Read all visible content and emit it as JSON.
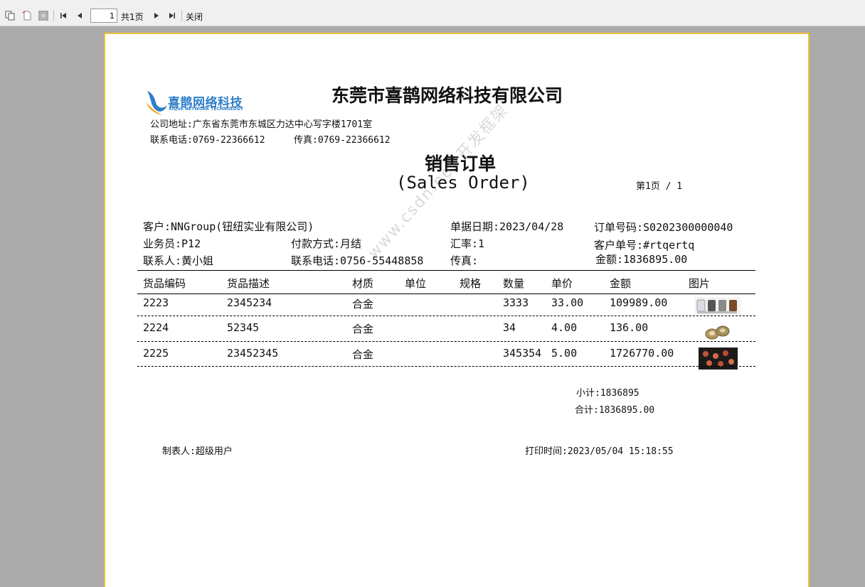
{
  "toolbar": {
    "page_value": "1",
    "total_pages": "共1页",
    "close_label": "关闭",
    "buttons": [
      "copy-icon",
      "export-icon",
      "print-icon",
      "first-page-icon",
      "prev-page-icon",
      "next-page-icon",
      "last-page-icon"
    ]
  },
  "header": {
    "logo_text": "喜鹊网络科技",
    "logo_sub": "XIQUE NETWORK TECHNOLOGY",
    "company_name": "东莞市喜鹊网络科技有限公司",
    "address": "公司地址:广东省东莞市东城区力达中心写字楼1701室",
    "phone": "联系电话:0769-22366612",
    "fax": "传真:0769-22366612"
  },
  "title": {
    "cn": "销售订单",
    "en": "(Sales Order)",
    "page_info": "第1页 / 1"
  },
  "info": {
    "customer": "客户:NNGroup(钮纽实业有限公司)",
    "doc_date": "单据日期:2023/04/28",
    "order_no": "订单号码:S0202300000040",
    "salesman": "业务员:P12",
    "payment": "付款方式:月结",
    "rate": "汇率:1",
    "customer_no": "客户单号:#rtqertq",
    "contact": "联系人:黄小姐",
    "contact_phone": "联系电话:0756-55448858",
    "fax": "传真:",
    "amount": "金额:1836895.00"
  },
  "table": {
    "headers": [
      "货品编码",
      "货品描述",
      "材质",
      "单位",
      "规格",
      "数量",
      "单价",
      "金额",
      "图片"
    ],
    "rows": [
      {
        "code": "2223",
        "desc": "2345234",
        "material": "合金",
        "unit": "",
        "spec": "",
        "qty": "3333",
        "price": "33.00",
        "amount": "109989.00",
        "image": "product-image-bottles"
      },
      {
        "code": "2224",
        "desc": "52345",
        "material": "合金",
        "unit": "",
        "spec": "",
        "qty": "34",
        "price": "4.00",
        "amount": "136.00",
        "image": "product-image-buttons"
      },
      {
        "code": "2225",
        "desc": "23452345",
        "material": "合金",
        "unit": "",
        "spec": "",
        "qty": "345354",
        "price": "5.00",
        "amount": "1726770.00",
        "image": "product-image-parts"
      }
    ]
  },
  "totals": {
    "subtotal": "小计:1836895",
    "total": "合计:1836895.00"
  },
  "footer": {
    "maker": "制表人:超级用户",
    "print_time": "打印时间:2023/05/04 15:18:55"
  },
  "watermark": "www.csdn.net 开发框架"
}
